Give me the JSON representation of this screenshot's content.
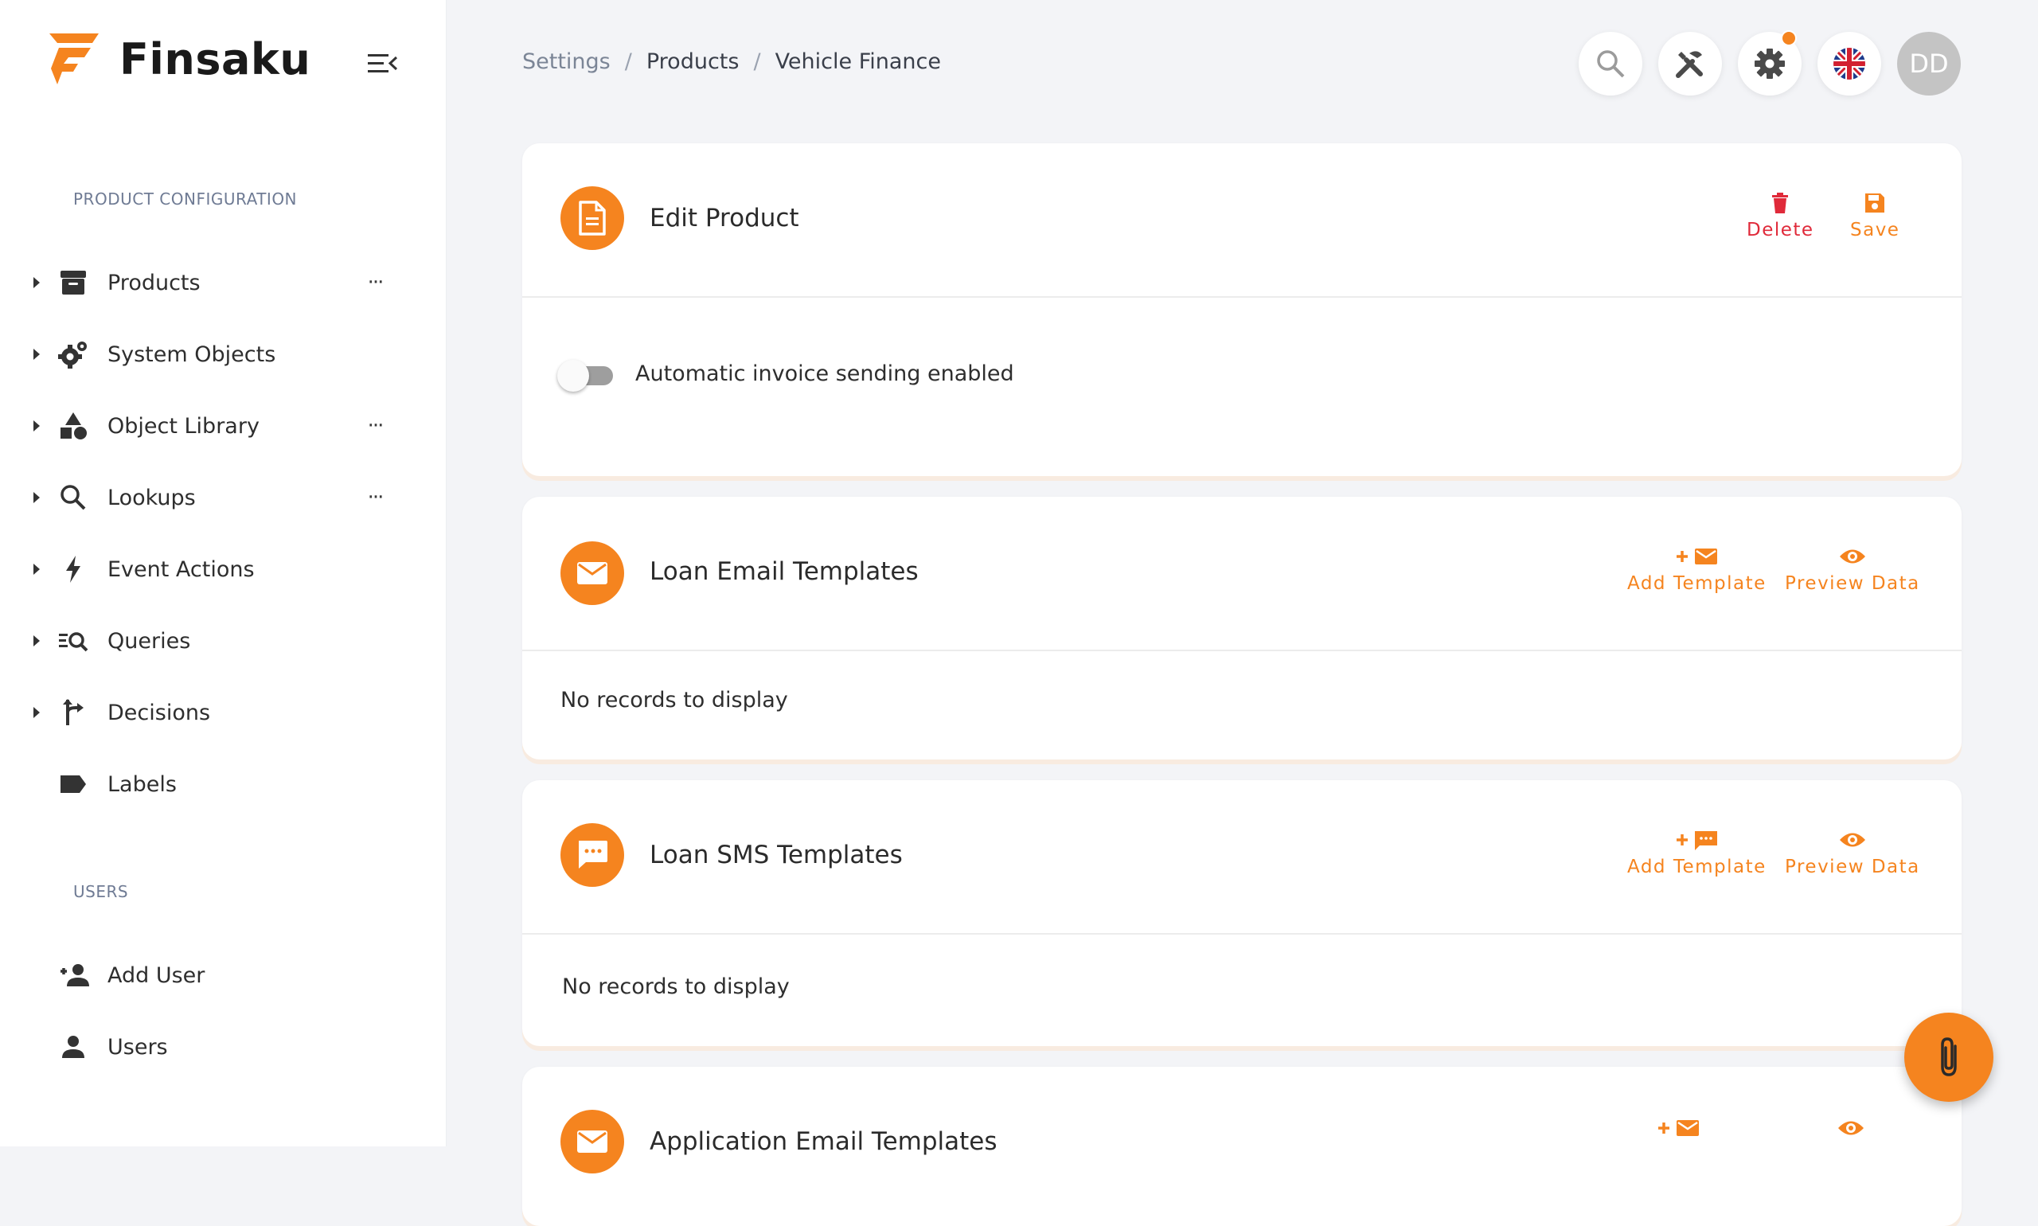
{
  "app": {
    "name": "Finsaku"
  },
  "colors": {
    "accent": "#f5841f",
    "danger": "#e02a3a",
    "avatar_bg": "#c4c4c4"
  },
  "sidebar": {
    "sections": [
      {
        "label": "PRODUCT CONFIGURATION"
      },
      {
        "label": "USERS"
      }
    ],
    "items": [
      {
        "label": "Products",
        "icon": "archive-icon",
        "has_more": true
      },
      {
        "label": "System Objects",
        "icon": "gears-icon",
        "has_more": false
      },
      {
        "label": "Object Library",
        "icon": "shapes-icon",
        "has_more": true
      },
      {
        "label": "Lookups",
        "icon": "search-icon",
        "has_more": true
      },
      {
        "label": "Event Actions",
        "icon": "bolt-icon",
        "has_more": false
      },
      {
        "label": "Queries",
        "icon": "query-icon",
        "has_more": false
      },
      {
        "label": "Decisions",
        "icon": "split-arrow-icon",
        "has_more": false
      },
      {
        "label": "Labels",
        "icon": "label-icon",
        "has_more": false
      }
    ],
    "user_items": [
      {
        "label": "Add User",
        "icon": "add-user-icon"
      },
      {
        "label": "Users",
        "icon": "user-icon"
      }
    ],
    "more_glyph": "···"
  },
  "header": {
    "breadcrumb": [
      "Settings",
      "Products",
      "Vehicle Finance"
    ],
    "separator": "/",
    "avatar_initials": "DD"
  },
  "cards": {
    "edit_product": {
      "title": "Edit Product",
      "delete_label": "Delete",
      "save_label": "Save",
      "toggle_label": "Automatic invoice sending enabled",
      "toggle_on": false
    },
    "loan_email": {
      "title": "Loan Email Templates",
      "add_label": "Add Template",
      "preview_label": "Preview Data",
      "empty_text": "No records to display"
    },
    "loan_sms": {
      "title": "Loan SMS Templates",
      "add_label": "Add Template",
      "preview_label": "Preview Data",
      "empty_text": "No records to display"
    },
    "application_email": {
      "title": "Application Email Templates"
    }
  }
}
